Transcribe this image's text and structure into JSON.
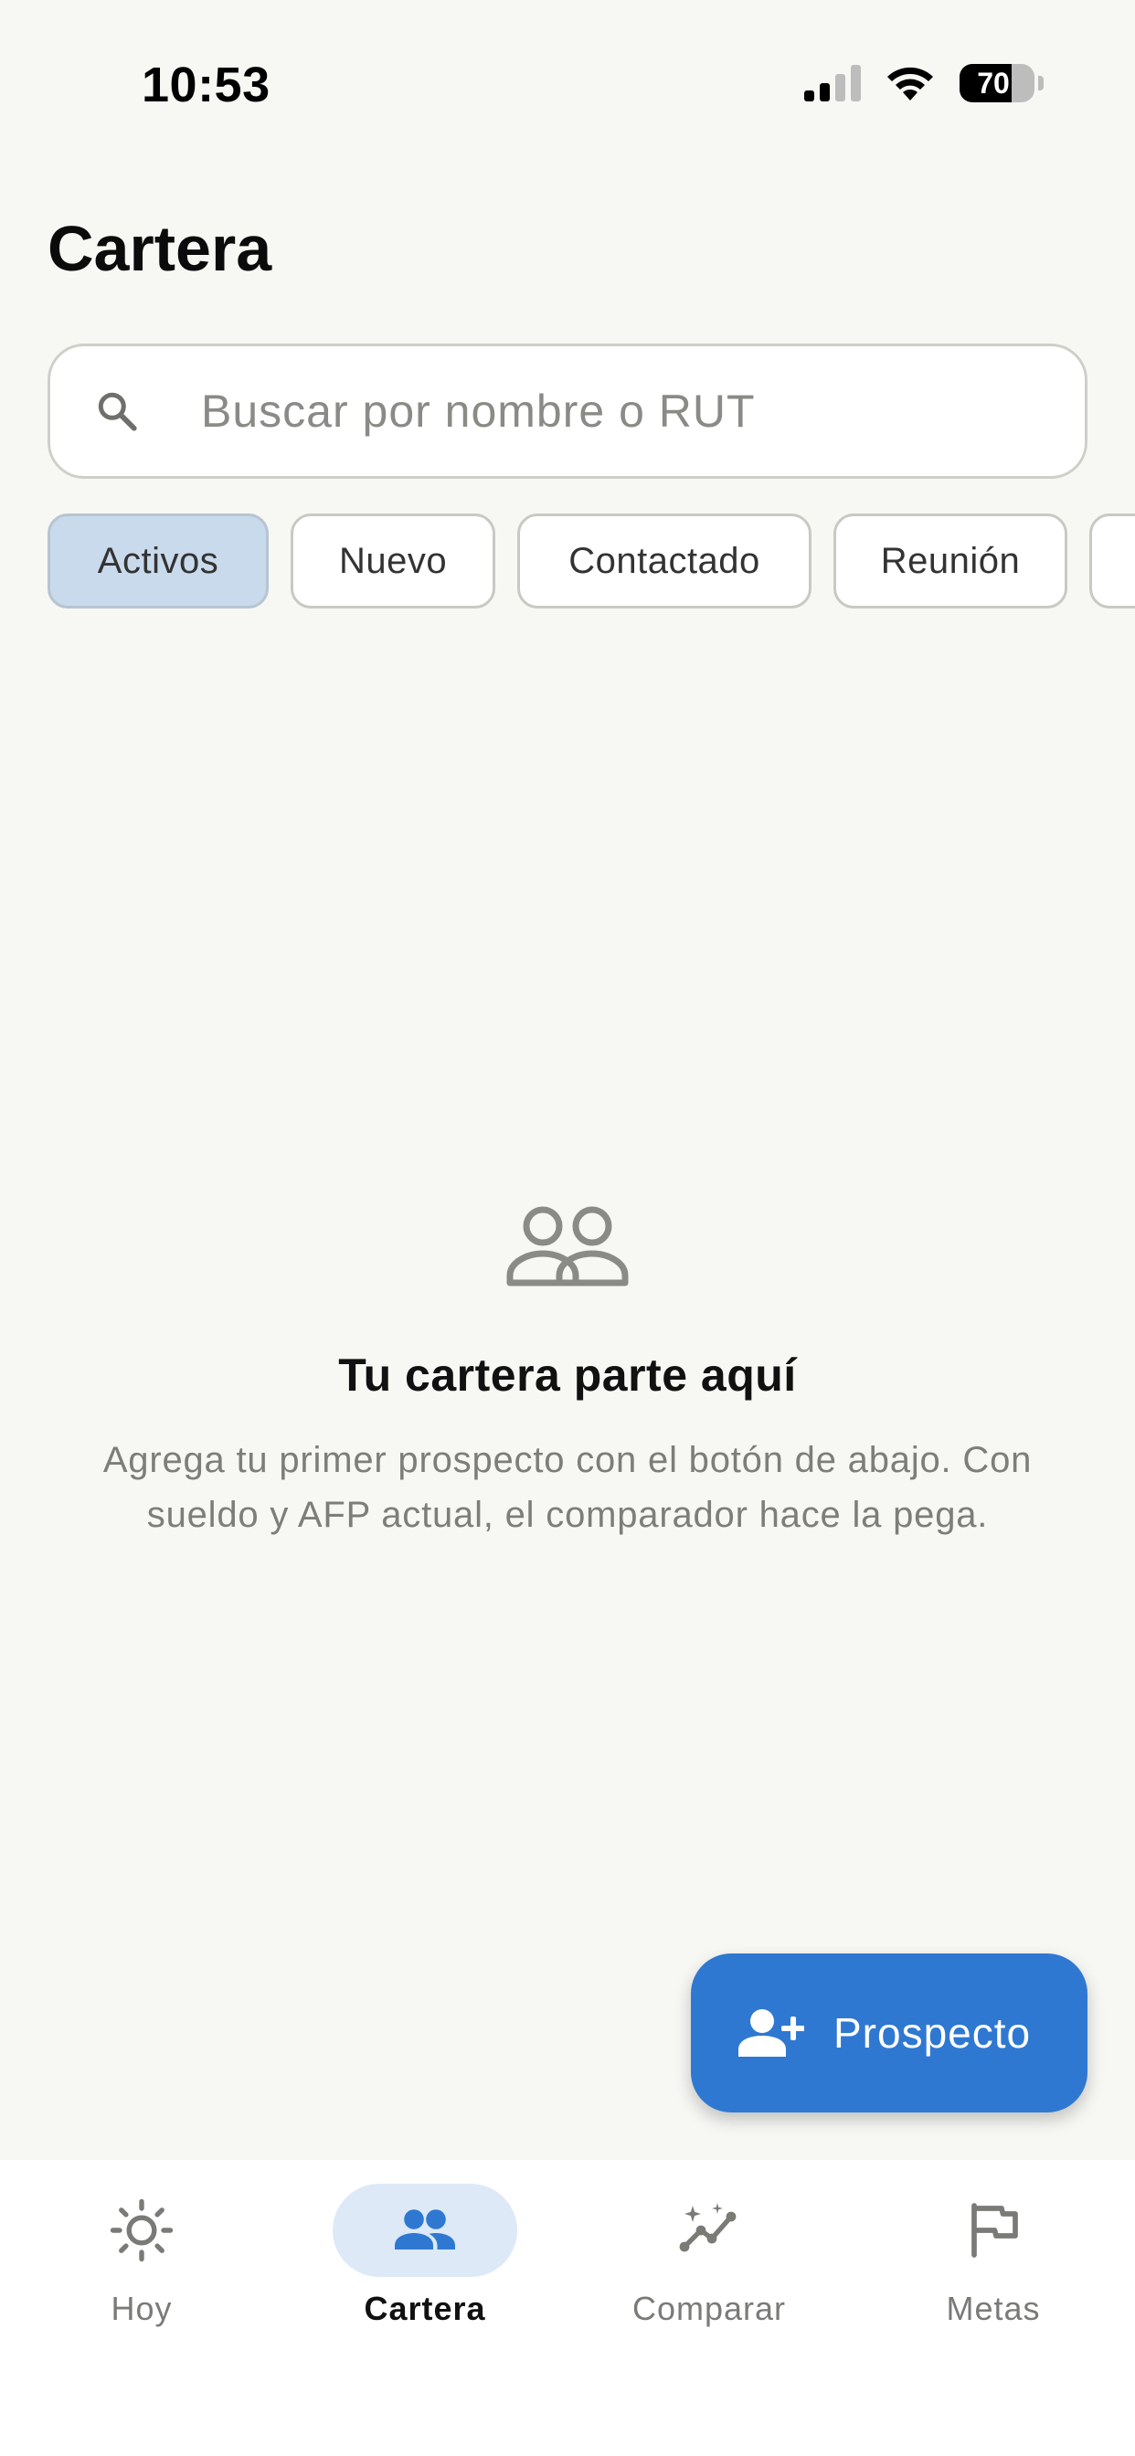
{
  "status_bar": {
    "time": "10:53",
    "battery": "70",
    "battery_level_pct": 70
  },
  "header": {
    "title": "Cartera"
  },
  "search": {
    "icon": "search-icon",
    "placeholder": "Buscar por nombre o RUT",
    "value": ""
  },
  "filters": {
    "selected": "Activos",
    "chips": [
      {
        "label": "Activos",
        "active": true
      },
      {
        "label": "Nuevo",
        "active": false
      },
      {
        "label": "Contactado",
        "active": false
      },
      {
        "label": "Reunión",
        "active": false
      },
      {
        "label": "",
        "active": false
      }
    ]
  },
  "empty_state": {
    "icon": "people-icon",
    "title": "Tu cartera parte aquí",
    "message": "Agrega tu primer prospecto con el botón de abajo. Con sueldo y AFP actual, el comparador hace la pega."
  },
  "fab": {
    "icon": "person-add-icon",
    "label": "Prospecto"
  },
  "bottom_nav": {
    "items": [
      {
        "label": "Hoy",
        "icon": "sun-icon",
        "active": false
      },
      {
        "label": "Cartera",
        "icon": "people-icon",
        "active": true
      },
      {
        "label": "Comparar",
        "icon": "sparkle-chart-icon",
        "active": false
      },
      {
        "label": "Metas",
        "icon": "flag-icon",
        "active": false
      }
    ]
  },
  "colors": {
    "background": "#f7f7f4",
    "accent": "#2f78d2",
    "chip_active": "#c9daec",
    "nav_active_pill": "#dde9f7",
    "muted_text": "#7d7d79"
  }
}
